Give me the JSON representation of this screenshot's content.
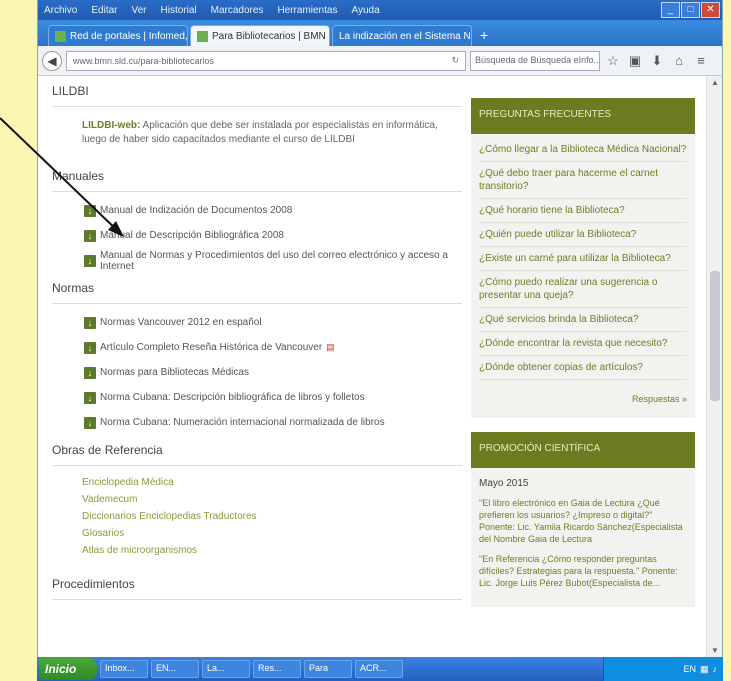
{
  "menubar": {
    "items": [
      "Archivo",
      "Editar",
      "Ver",
      "Historial",
      "Marcadores",
      "Herramientas",
      "Ayuda"
    ]
  },
  "tabs": [
    {
      "label": "Red de portales | Infomed, t...",
      "active": false
    },
    {
      "label": "Para Bibliotecarios | BMN",
      "active": true
    },
    {
      "label": "La indización en el Sistema Nacion...",
      "active": false
    }
  ],
  "newtab": "+",
  "addressbar": {
    "url": "www.bmn.sld.cu/para-bibliotecarios",
    "search_placeholder": "Búsqueda de Búsqueda eInfo..."
  },
  "lildbi": {
    "title": "LILDBI",
    "link": "LILDBI-web:",
    "text": " Aplicación que debe ser instalada por especialistas en informática, luego de haber sido capacitados mediante el curso de LILDBI"
  },
  "manuales": {
    "title": "Manuales",
    "items": [
      "Manual de Indización de Documentos 2008",
      "Manual de Descripción Bibliográfica 2008",
      "Manual de Normas y Procedimientos del uso del correo electrónico y acceso a Internet"
    ]
  },
  "normas": {
    "title": "Normas",
    "items": [
      "Normas Vancouver 2012 en español",
      "Artículo Completo Reseña Histórica de Vancouver",
      "Normas para Bibliotecas Médicas",
      "Norma Cubana: Descripción bibliográfica de libros y folletos",
      "Norma Cubana: Numeración internacional normalizada de libros"
    ]
  },
  "referencia": {
    "title": "Obras de Referencia",
    "items": [
      "Enciclopedia Médica",
      "Vademecum",
      "Diccionarios Enciclopedias Traductores",
      "Glosarios",
      "Atlas de microorganismos"
    ]
  },
  "procedimientos": {
    "title": "Procedimientos"
  },
  "faq": {
    "title": "PREGUNTAS FRECUENTES",
    "items": [
      "¿Cómo llegar a la Biblioteca Médica Nacional?",
      "¿Qué debo traer para hacerme el carnet transitorio?",
      "¿Qué horario tiene la Biblioteca?",
      "¿Quién puede utilizar la Biblioteca?",
      "¿Existe un carné para utilizar la Biblioteca?",
      "¿Cómo puedo realizar una sugerencia o presentar una queja?",
      "¿Qué servicios brinda la Biblioteca?",
      "¿Dónde encontrar la revista que necesito?",
      "¿Dónde obtener copias de artículos?"
    ],
    "more": "Respuestas »"
  },
  "promocion": {
    "title": "PROMOCIÓN CIENTÍFICA",
    "date": "Mayo 2015",
    "items": [
      "\"El libro electrónico en Gaia de Lectura ¿Qué prefieren los usuarios? ¿Impreso o digital?\" Ponente: Lic. Yamila Ricardo Sánchez(Especialista del Nombre Gaia de Lectura",
      "\"En Referencia ¿Cómo responder preguntas difíciles? Estrategias para la respuesta.\" Ponente: Lic. Jorge Luis Pérez Bubot(Especialista de..."
    ]
  },
  "taskbar": {
    "start": "Inicio",
    "items": [
      "Inbox...",
      "EN...",
      "La...",
      "Res...",
      "Para",
      "ACR..."
    ],
    "tray": "EN"
  },
  "colors": {
    "accent": "#6e7a1f",
    "link": "#8a9b3c",
    "taskbar": "#2461c0"
  },
  "icons": {
    "download": "download-icon",
    "pdf": "pdf-icon"
  }
}
